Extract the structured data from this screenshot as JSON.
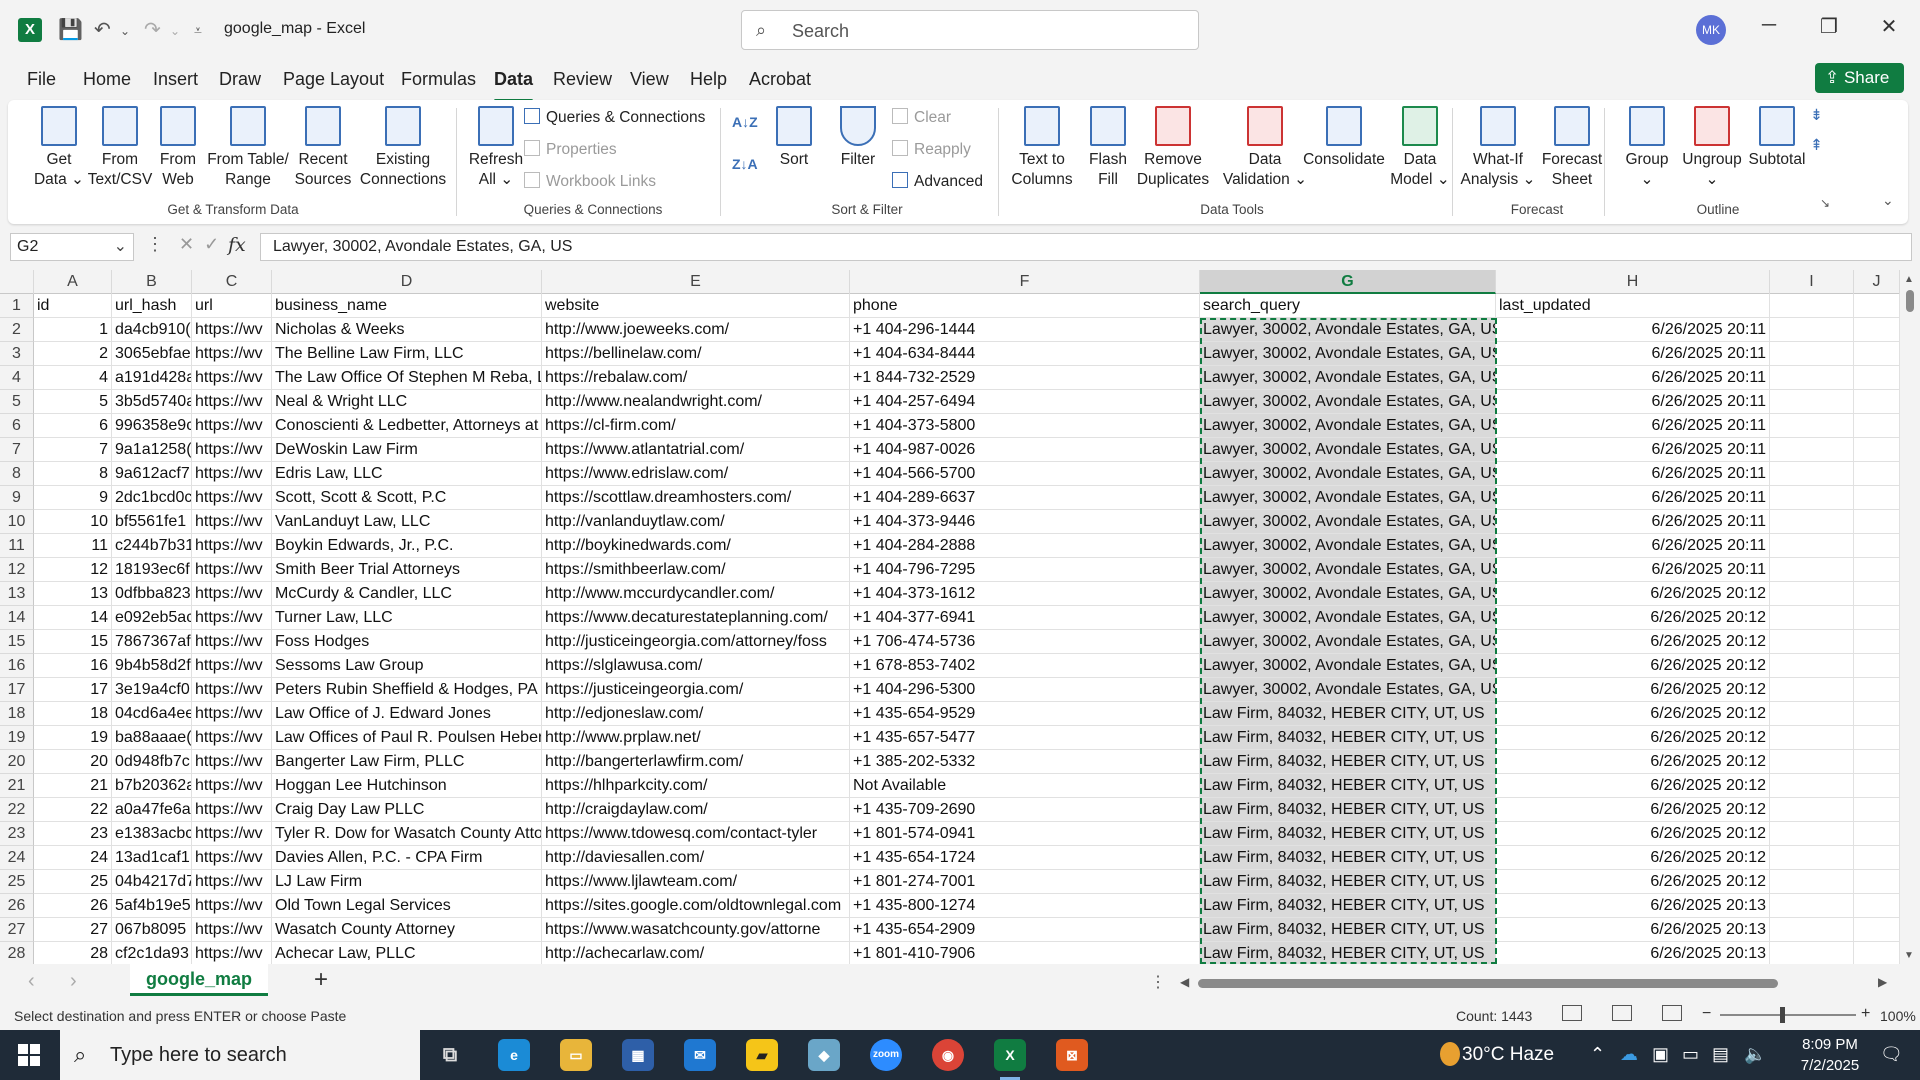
{
  "window": {
    "title": "google_map  -  Excel",
    "search_placeholder": "Search",
    "user_initials": "MK",
    "minimize": "─",
    "restore": "❐",
    "close": "✕"
  },
  "menu": {
    "tabs": [
      "File",
      "Home",
      "Insert",
      "Draw",
      "Page Layout",
      "Formulas",
      "Data",
      "Review",
      "View",
      "Help",
      "Acrobat"
    ],
    "active": "Data",
    "share": "Share"
  },
  "ribbon": {
    "get_data": "Get\nData ⌄",
    "from_text": "From\nText/CSV",
    "from_web": "From\nWeb",
    "from_table": "From Table/\nRange",
    "recent_sources": "Recent\nSources",
    "existing_connections": "Existing\nConnections",
    "group_get_transform": "Get & Transform Data",
    "refresh_all": "Refresh\nAll ⌄",
    "queries_connections": "Queries & Connections",
    "properties": "Properties",
    "workbook_links": "Workbook Links",
    "group_queries": "Queries & Connections",
    "sort_az": "A↓Z",
    "sort_za": "Z↓A",
    "sort": "Sort",
    "filter": "Filter",
    "clear": "Clear",
    "reapply": "Reapply",
    "advanced": "Advanced",
    "group_sort_filter": "Sort & Filter",
    "text_to_columns": "Text to\nColumns",
    "flash_fill": "Flash\nFill",
    "remove_duplicates": "Remove\nDuplicates",
    "data_validation": "Data\nValidation ⌄",
    "consolidate": "Consolidate",
    "data_model": "Data\nModel ⌄",
    "group_data_tools": "Data Tools",
    "what_if": "What-If\nAnalysis ⌄",
    "forecast_sheet": "Forecast\nSheet",
    "group_forecast": "Forecast",
    "group": "Group\n⌄",
    "ungroup": "Ungroup\n⌄",
    "subtotal": "Subtotal",
    "group_outline": "Outline"
  },
  "formula_bar": {
    "name_box": "G2",
    "fx": "fx",
    "formula": "Lawyer, 30002, Avondale Estates, GA, US"
  },
  "columns": [
    "A",
    "B",
    "C",
    "D",
    "E",
    "F",
    "G",
    "H",
    "I",
    "J"
  ],
  "header_row": [
    "id",
    "url_hash",
    "url",
    "business_name",
    "website",
    "phone",
    "search_query",
    "last_updated"
  ],
  "rows": [
    {
      "n": "2",
      "id": "1",
      "hash": "da4cb910(",
      "url": "https://wv",
      "name": "Nicholas & Weeks",
      "web": "http://www.joeweeks.com/",
      "phone": "+1 404-296-1444",
      "q": "Lawyer, 30002, Avondale Estates, GA, US",
      "t": "6/26/2025 20:11"
    },
    {
      "n": "3",
      "id": "2",
      "hash": "3065ebfae",
      "url": "https://wv",
      "name": "The Belline Law Firm, LLC",
      "web": "https://bellinelaw.com/",
      "phone": "+1 404-634-8444",
      "q": "Lawyer, 30002, Avondale Estates, GA, US",
      "t": "6/26/2025 20:11"
    },
    {
      "n": "4",
      "id": "4",
      "hash": "a191d428a",
      "url": "https://wv",
      "name": "The Law Office Of Stephen M Reba, LLC",
      "web": "https://rebalaw.com/",
      "phone": "+1 844-732-2529",
      "q": "Lawyer, 30002, Avondale Estates, GA, US",
      "t": "6/26/2025 20:11"
    },
    {
      "n": "5",
      "id": "5",
      "hash": "3b5d5740a",
      "url": "https://wv",
      "name": "Neal & Wright LLC",
      "web": "http://www.nealandwright.com/",
      "phone": "+1 404-257-6494",
      "q": "Lawyer, 30002, Avondale Estates, GA, US",
      "t": "6/26/2025 20:11"
    },
    {
      "n": "6",
      "id": "6",
      "hash": "996358e9c",
      "url": "https://wv",
      "name": "Conoscienti & Ledbetter, Attorneys at Law",
      "web": "https://cl-firm.com/",
      "phone": "+1 404-373-5800",
      "q": "Lawyer, 30002, Avondale Estates, GA, US",
      "t": "6/26/2025 20:11"
    },
    {
      "n": "7",
      "id": "7",
      "hash": "9a1a1258(",
      "url": "https://wv",
      "name": "DeWoskin Law Firm",
      "web": "https://www.atlantatrial.com/",
      "phone": "+1 404-987-0026",
      "q": "Lawyer, 30002, Avondale Estates, GA, US",
      "t": "6/26/2025 20:11"
    },
    {
      "n": "8",
      "id": "8",
      "hash": "9a612acf7",
      "url": "https://wv",
      "name": "Edris Law, LLC",
      "web": "https://www.edrislaw.com/",
      "phone": "+1 404-566-5700",
      "q": "Lawyer, 30002, Avondale Estates, GA, US",
      "t": "6/26/2025 20:11"
    },
    {
      "n": "9",
      "id": "9",
      "hash": "2dc1bcd0c",
      "url": "https://wv",
      "name": "Scott, Scott & Scott, P.C",
      "web": "https://scottlaw.dreamhosters.com/",
      "phone": "+1 404-289-6637",
      "q": "Lawyer, 30002, Avondale Estates, GA, US",
      "t": "6/26/2025 20:11"
    },
    {
      "n": "10",
      "id": "10",
      "hash": "bf5561fe1",
      "url": "https://wv",
      "name": "VanLanduyt Law, LLC",
      "web": "http://vanlanduytlaw.com/",
      "phone": "+1 404-373-9446",
      "q": "Lawyer, 30002, Avondale Estates, GA, US",
      "t": "6/26/2025 20:11"
    },
    {
      "n": "11",
      "id": "11",
      "hash": "c244b7b31",
      "url": "https://wv",
      "name": "Boykin Edwards, Jr., P.C.",
      "web": "http://boykinedwards.com/",
      "phone": "+1 404-284-2888",
      "q": "Lawyer, 30002, Avondale Estates, GA, US",
      "t": "6/26/2025 20:11"
    },
    {
      "n": "12",
      "id": "12",
      "hash": "18193ec6f",
      "url": "https://wv",
      "name": "Smith Beer Trial Attorneys",
      "web": "https://smithbeerlaw.com/",
      "phone": "+1 404-796-7295",
      "q": "Lawyer, 30002, Avondale Estates, GA, US",
      "t": "6/26/2025 20:11"
    },
    {
      "n": "13",
      "id": "13",
      "hash": "0dfbba823",
      "url": "https://wv",
      "name": "McCurdy & Candler, LLC",
      "web": "http://www.mccurdycandler.com/",
      "phone": "+1 404-373-1612",
      "q": "Lawyer, 30002, Avondale Estates, GA, US",
      "t": "6/26/2025 20:12"
    },
    {
      "n": "14",
      "id": "14",
      "hash": "e092eb5ac",
      "url": "https://wv",
      "name": "Turner Law, LLC",
      "web": "https://www.decaturestateplanning.com/",
      "phone": "+1 404-377-6941",
      "q": "Lawyer, 30002, Avondale Estates, GA, US",
      "t": "6/26/2025 20:12"
    },
    {
      "n": "15",
      "id": "15",
      "hash": "7867367af",
      "url": "https://wv",
      "name": "Foss Hodges",
      "web": "http://justiceingeorgia.com/attorney/foss",
      "phone": "+1 706-474-5736",
      "q": "Lawyer, 30002, Avondale Estates, GA, US",
      "t": "6/26/2025 20:12"
    },
    {
      "n": "16",
      "id": "16",
      "hash": "9b4b58d2f",
      "url": "https://wv",
      "name": "Sessoms Law Group",
      "web": "https://slglawusa.com/",
      "phone": "+1 678-853-7402",
      "q": "Lawyer, 30002, Avondale Estates, GA, US",
      "t": "6/26/2025 20:12"
    },
    {
      "n": "17",
      "id": "17",
      "hash": "3e19a4cf0",
      "url": "https://wv",
      "name": "Peters Rubin Sheffield & Hodges, PA",
      "web": "https://justiceingeorgia.com/",
      "phone": "+1 404-296-5300",
      "q": "Lawyer, 30002, Avondale Estates, GA, US",
      "t": "6/26/2025 20:12"
    },
    {
      "n": "18",
      "id": "18",
      "hash": "04cd6a4ee",
      "url": "https://wv",
      "name": "Law Office of J. Edward Jones",
      "web": "http://edjoneslaw.com/",
      "phone": "+1 435-654-9529",
      "q": "Law Firm, 84032, HEBER CITY, UT, US",
      "t": "6/26/2025 20:12"
    },
    {
      "n": "19",
      "id": "19",
      "hash": "ba88aaae(",
      "url": "https://wv",
      "name": "Law Offices of Paul R. Poulsen Heber",
      "web": "http://www.prplaw.net/",
      "phone": "+1 435-657-5477",
      "q": "Law Firm, 84032, HEBER CITY, UT, US",
      "t": "6/26/2025 20:12"
    },
    {
      "n": "20",
      "id": "20",
      "hash": "0d948fb7c",
      "url": "https://wv",
      "name": "Bangerter Law Firm, PLLC",
      "web": "http://bangerterlawfirm.com/",
      "phone": "+1 385-202-5332",
      "q": "Law Firm, 84032, HEBER CITY, UT, US",
      "t": "6/26/2025 20:12"
    },
    {
      "n": "21",
      "id": "21",
      "hash": "b7b20362a",
      "url": "https://wv",
      "name": "Hoggan Lee Hutchinson",
      "web": "https://hlhparkcity.com/",
      "phone": "Not Available",
      "q": "Law Firm, 84032, HEBER CITY, UT, US",
      "t": "6/26/2025 20:12"
    },
    {
      "n": "22",
      "id": "22",
      "hash": "a0a47fe6a",
      "url": "https://wv",
      "name": "Craig Day Law PLLC",
      "web": "http://craigdaylaw.com/",
      "phone": "+1 435-709-2690",
      "q": "Law Firm, 84032, HEBER CITY, UT, US",
      "t": "6/26/2025 20:12"
    },
    {
      "n": "23",
      "id": "23",
      "hash": "e1383acbc",
      "url": "https://wv",
      "name": "Tyler R. Dow for Wasatch County Attorney",
      "web": "https://www.tdowesq.com/contact-tyler",
      "phone": "+1 801-574-0941",
      "q": "Law Firm, 84032, HEBER CITY, UT, US",
      "t": "6/26/2025 20:12"
    },
    {
      "n": "24",
      "id": "24",
      "hash": "13ad1caf1",
      "url": "https://wv",
      "name": "Davies Allen, P.C. - CPA Firm",
      "web": "http://daviesallen.com/",
      "phone": "+1 435-654-1724",
      "q": "Law Firm, 84032, HEBER CITY, UT, US",
      "t": "6/26/2025 20:12"
    },
    {
      "n": "25",
      "id": "25",
      "hash": "04b4217d7",
      "url": "https://wv",
      "name": "LJ Law Firm",
      "web": "https://www.ljlawteam.com/",
      "phone": "+1 801-274-7001",
      "q": "Law Firm, 84032, HEBER CITY, UT, US",
      "t": "6/26/2025 20:12"
    },
    {
      "n": "26",
      "id": "26",
      "hash": "5af4b19e5",
      "url": "https://wv",
      "name": "Old Town Legal Services",
      "web": "https://sites.google.com/oldtownlegal.com",
      "phone": "+1 435-800-1274",
      "q": "Law Firm, 84032, HEBER CITY, UT, US",
      "t": "6/26/2025 20:13"
    },
    {
      "n": "27",
      "id": "27",
      "hash": "067b8095",
      "url": "https://wv",
      "name": "Wasatch County Attorney",
      "web": "https://www.wasatchcounty.gov/attorne",
      "phone": "+1 435-654-2909",
      "q": "Law Firm, 84032, HEBER CITY, UT, US",
      "t": "6/26/2025 20:13"
    },
    {
      "n": "28",
      "id": "28",
      "hash": "cf2c1da93",
      "url": "https://wv",
      "name": "Achecar Law, PLLC",
      "web": "http://achecarlaw.com/",
      "phone": "+1 801-410-7906",
      "q": "Law Firm, 84032, HEBER CITY, UT, US",
      "t": "6/26/2025 20:13"
    }
  ],
  "sheet": {
    "tab": "google_map",
    "add": "+",
    "more": "⋮"
  },
  "status": {
    "message": "Select destination and press ENTER or choose Paste",
    "count": "Count: 1443",
    "zoom": "100%",
    "minus": "−",
    "plus": "+"
  },
  "taskbar": {
    "search_placeholder": "Type here to search",
    "weather": "30°C  Haze",
    "time": "8:09 PM",
    "date": "7/2/2025"
  },
  "colors": {
    "excel_green": "#107c41",
    "selection_fill": "#d9d9d9",
    "taskbar": "#1f2b38"
  }
}
